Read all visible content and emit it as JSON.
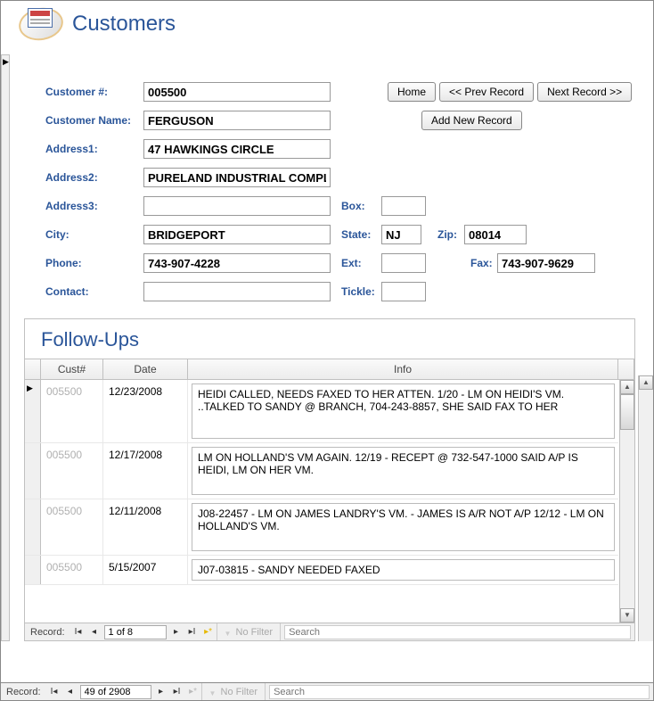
{
  "header": {
    "title": "Customers"
  },
  "buttons": {
    "home": "Home",
    "prev": "<< Prev Record",
    "next": "Next Record >>",
    "add": "Add New Record"
  },
  "labels": {
    "customer_num": "Customer #:",
    "customer_name": "Customer Name:",
    "address1": "Address1:",
    "address2": "Address2:",
    "address3": "Address3:",
    "city": "City:",
    "phone": "Phone:",
    "contact": "Contact:",
    "box": "Box:",
    "state": "State:",
    "zip": "Zip:",
    "ext": "Ext:",
    "fax": "Fax:",
    "tickle": "Tickle:"
  },
  "customer": {
    "number": "005500",
    "name": "FERGUSON",
    "address1": "47 HAWKINGS CIRCLE",
    "address2": "PURELAND INDUSTRIAL COMPLEX",
    "address3": "",
    "city": "BRIDGEPORT",
    "state": "NJ",
    "zip": "08014",
    "phone": "743-907-4228",
    "ext": "",
    "fax": "743-907-9629",
    "contact": "",
    "box": "",
    "tickle": ""
  },
  "subform": {
    "title": "Follow-Ups",
    "columns": {
      "cust": "Cust#",
      "date": "Date",
      "info": "Info"
    },
    "rows": [
      {
        "cust": "005500",
        "date": "12/23/2008",
        "info": "HEIDI CALLED, NEEDS FAXED TO HER ATTEN.    1/20 - LM ON HEIDI'S VM.    ..TALKED TO SANDY @ BRANCH, 704-243-8857, SHE SAID FAX TO HER"
      },
      {
        "cust": "005500",
        "date": "12/17/2008",
        "info": "LM ON HOLLAND'S VM AGAIN.    12/19 - RECEPT @ 732-547-1000 SAID A/P IS HEIDI, LM ON HER VM."
      },
      {
        "cust": "005500",
        "date": "12/11/2008",
        "info": "J08-22457 - LM ON JAMES LANDRY'S VM. - JAMES IS A/R NOT A/P   12/12 - LM ON HOLLAND'S VM."
      },
      {
        "cust": "005500",
        "date": "5/15/2007",
        "info": "J07-03815 - SANDY NEEDED FAXED"
      }
    ],
    "nav": {
      "label": "Record:",
      "position": "1 of 8",
      "filter": "No Filter",
      "search_placeholder": "Search"
    }
  },
  "outer_nav": {
    "label": "Record:",
    "position": "49 of 2908",
    "filter": "No Filter",
    "search_placeholder": "Search"
  }
}
